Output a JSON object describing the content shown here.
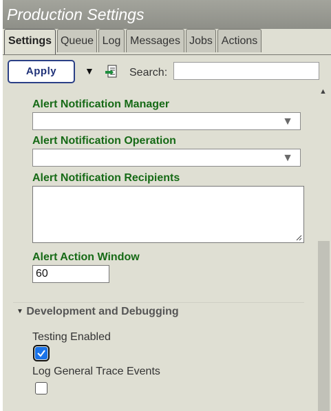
{
  "window": {
    "title": "Production Settings"
  },
  "tabs": [
    {
      "label": "Settings",
      "active": true
    },
    {
      "label": "Queue"
    },
    {
      "label": "Log"
    },
    {
      "label": "Messages"
    },
    {
      "label": "Jobs"
    },
    {
      "label": "Actions"
    }
  ],
  "toolbar": {
    "apply_label": "Apply",
    "search_label": "Search:",
    "search_value": ""
  },
  "settings": {
    "alert_notification_manager": {
      "label": "Alert Notification Manager",
      "value": ""
    },
    "alert_notification_operation": {
      "label": "Alert Notification Operation",
      "value": ""
    },
    "alert_notification_recipients": {
      "label": "Alert Notification Recipients",
      "value": ""
    },
    "alert_action_window": {
      "label": "Alert Action Window",
      "value": "60"
    }
  },
  "sections": {
    "development": {
      "title": "Development and Debugging",
      "expanded": true
    }
  },
  "debug": {
    "testing_enabled": {
      "label": "Testing Enabled",
      "checked": true
    },
    "log_general_trace": {
      "label": "Log General Trace Events",
      "checked": false
    }
  },
  "colors": {
    "label_green": "#166a16",
    "title_bar": "#9a9b94",
    "panel_bg": "#dfdfd3",
    "apply_border": "#2a3f86",
    "checkbox_blue": "#1a73e8"
  }
}
